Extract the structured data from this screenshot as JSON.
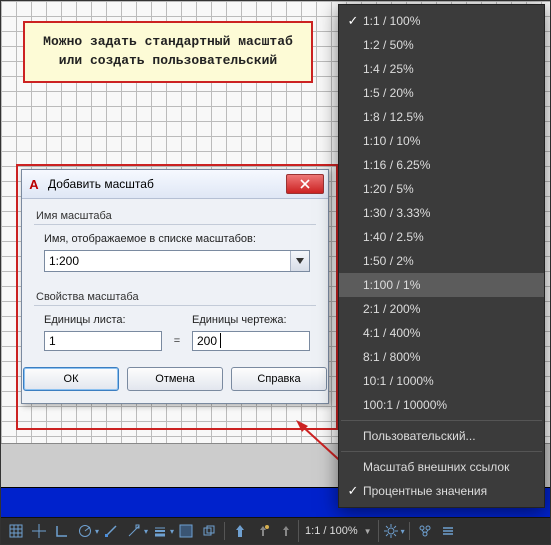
{
  "callout": {
    "text": "Можно задать стандартный масштаб или создать пользовательский"
  },
  "dialog": {
    "title": "Добавить масштаб",
    "group_name_label": "Имя масштаба",
    "name_field_label": "Имя, отображаемое в списке масштабов:",
    "name_value": "1:200",
    "group_props_label": "Свойства масштаба",
    "paper_units_label": "Единицы листа:",
    "drawing_units_label": "Единицы чертежа:",
    "paper_value": "1",
    "equals": "=",
    "drawing_value": "200",
    "btn_ok": "ОК",
    "btn_cancel": "Отмена",
    "btn_help": "Справка"
  },
  "menu": {
    "items": [
      {
        "label": "1:1 / 100%",
        "checked": true
      },
      {
        "label": "1:2 / 50%"
      },
      {
        "label": "1:4 / 25%"
      },
      {
        "label": "1:5 / 20%"
      },
      {
        "label": "1:8 / 12.5%"
      },
      {
        "label": "1:10 / 10%"
      },
      {
        "label": "1:16 / 6.25%"
      },
      {
        "label": "1:20 / 5%"
      },
      {
        "label": "1:30 / 3.33%"
      },
      {
        "label": "1:40 / 2.5%"
      },
      {
        "label": "1:50 / 2%"
      },
      {
        "label": "1:100 / 1%",
        "highlight": true
      },
      {
        "label": "2:1 / 200%"
      },
      {
        "label": "4:1 / 400%"
      },
      {
        "label": "8:1 / 800%"
      },
      {
        "label": "10:1 / 1000%"
      },
      {
        "label": "100:1 / 10000%"
      }
    ],
    "custom": "Пользовательский...",
    "xref": "Масштаб внешних ссылок",
    "percent": "Процентные значения",
    "percent_checked": true
  },
  "statusbar": {
    "scale": "1:1 / 100%"
  }
}
